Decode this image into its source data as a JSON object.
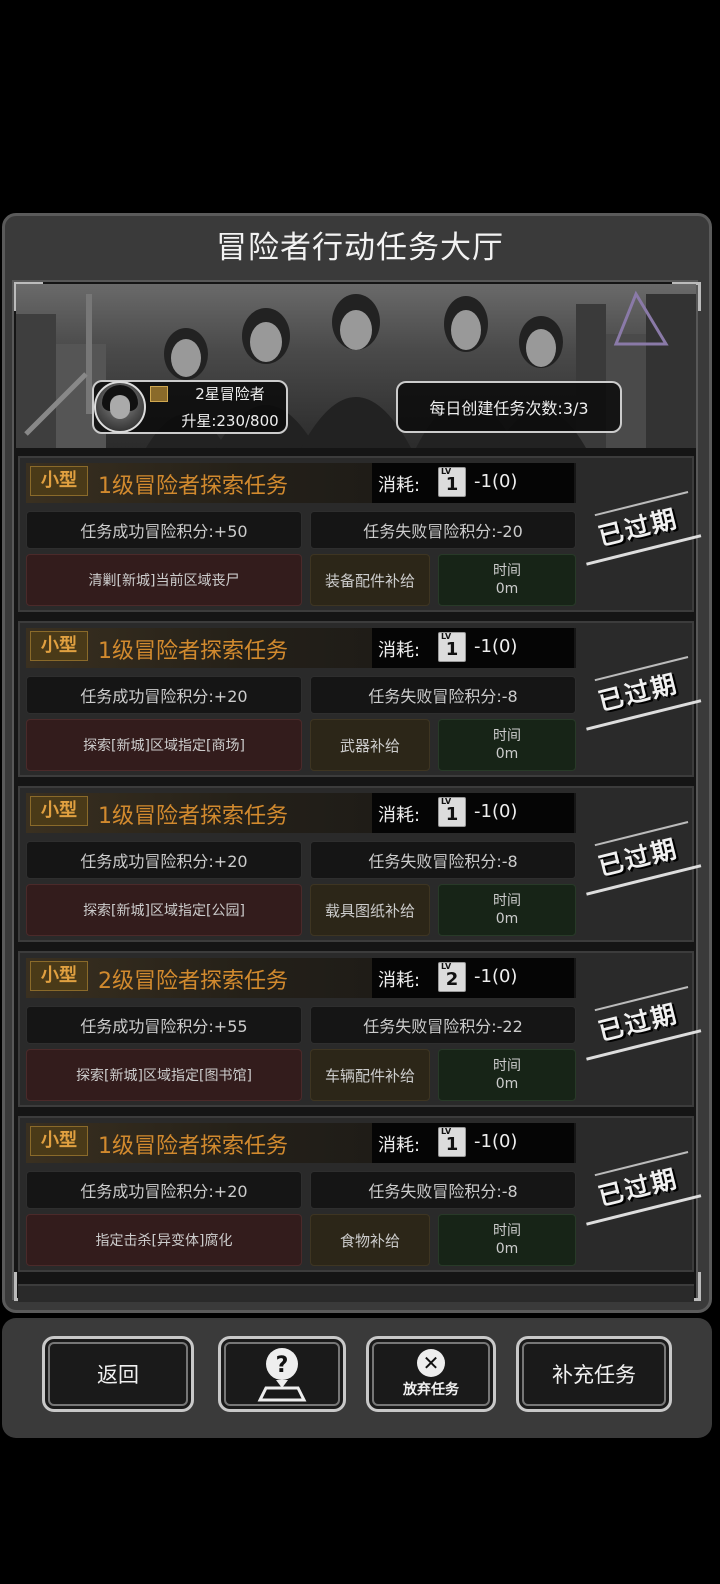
{
  "hall_title": "冒险者行动任务大厅",
  "profile": {
    "rank": "2星冒险者",
    "upgrade": "升星:230/800"
  },
  "daily_create": "每日创建任务次数:3/3",
  "cost_label": "消耗:",
  "tasks": [
    {
      "size": "小型",
      "name": "1级冒险者探索任务",
      "card_level": "1",
      "cost": "-1(0)",
      "success": "任务成功冒险积分:+50",
      "fail": "任务失败冒险积分:-20",
      "objective": "清剿[新城]当前区域丧尸",
      "reward": "装备配件补给",
      "time_label": "时间",
      "time_value": "0m",
      "status": "已过期"
    },
    {
      "size": "小型",
      "name": "1级冒险者探索任务",
      "card_level": "1",
      "cost": "-1(0)",
      "success": "任务成功冒险积分:+20",
      "fail": "任务失败冒险积分:-8",
      "objective": "探索[新城]区域指定[商场]",
      "reward": "武器补给",
      "time_label": "时间",
      "time_value": "0m",
      "status": "已过期"
    },
    {
      "size": "小型",
      "name": "1级冒险者探索任务",
      "card_level": "1",
      "cost": "-1(0)",
      "success": "任务成功冒险积分:+20",
      "fail": "任务失败冒险积分:-8",
      "objective": "探索[新城]区域指定[公园]",
      "reward": "载具图纸补给",
      "time_label": "时间",
      "time_value": "0m",
      "status": "已过期"
    },
    {
      "size": "小型",
      "name": "2级冒险者探索任务",
      "card_level": "2",
      "cost": "-1(0)",
      "success": "任务成功冒险积分:+55",
      "fail": "任务失败冒险积分:-22",
      "objective": "探索[新城]区域指定[图书馆]",
      "reward": "车辆配件补给",
      "time_label": "时间",
      "time_value": "0m",
      "status": "已过期"
    },
    {
      "size": "小型",
      "name": "1级冒险者探索任务",
      "card_level": "1",
      "cost": "-1(0)",
      "success": "任务成功冒险积分:+20",
      "fail": "任务失败冒险积分:-8",
      "objective": "指定击杀[异变体]腐化",
      "reward": "食物补给",
      "time_label": "时间",
      "time_value": "0m",
      "status": "已过期"
    }
  ],
  "buttons": {
    "back": "返回",
    "abandon": "放弃任务",
    "supply": "补充任务"
  },
  "icons": {
    "help": "question-map-icon",
    "abandon": "x-circle-icon",
    "card": "level-card-icon",
    "rank": "rank-badge-icon"
  }
}
